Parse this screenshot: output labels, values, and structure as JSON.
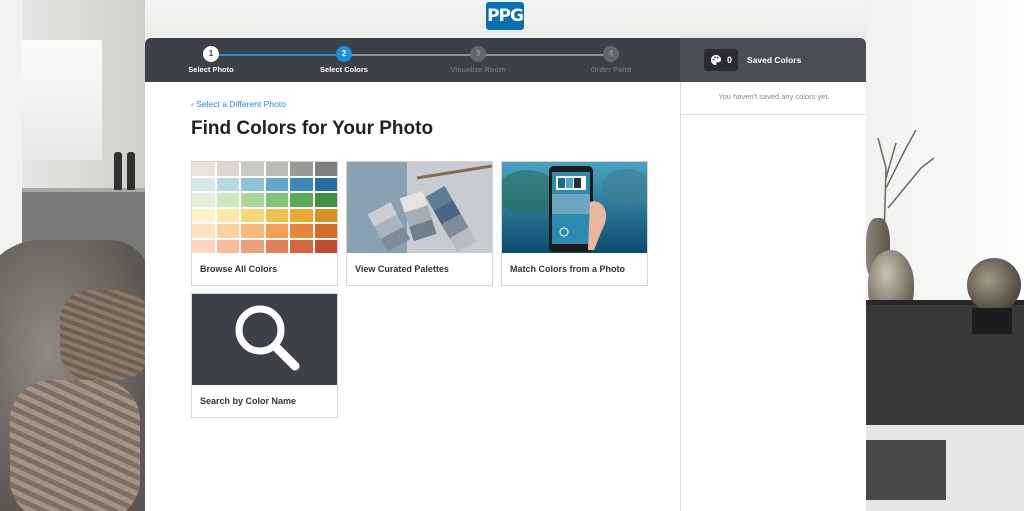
{
  "brand": {
    "logo_text": "PPG",
    "accent": "#1e8ee0",
    "header_bg": "#3d4046"
  },
  "steps": [
    {
      "num": "1",
      "label": "Select Photo",
      "state": "done"
    },
    {
      "num": "2",
      "label": "Select Colors",
      "state": "current"
    },
    {
      "num": "3",
      "label": "Visualize Room",
      "state": "todo"
    },
    {
      "num": "4",
      "label": "Order Paint",
      "state": "todo"
    }
  ],
  "saved": {
    "count": "0",
    "label": "Saved Colors",
    "empty_message": "You haven't saved any colors yet.",
    "icon": "palette-icon"
  },
  "main": {
    "back_link": "Select a Different Photo",
    "title": "Find Colors for Your Photo",
    "cards": [
      {
        "label": "Browse All Colors",
        "icon": "swatch-grid"
      },
      {
        "label": "View Curated Palettes",
        "icon": "palette-fan"
      },
      {
        "label": "Match Colors from a Photo",
        "icon": "phone-photo"
      },
      {
        "label": "Search by Color Name",
        "icon": "search-icon"
      }
    ],
    "swatches": [
      "#e8e3d8",
      "#dcd8cf",
      "#c9c9c3",
      "#b9bab5",
      "#9a9b97",
      "#7e807d",
      "#d6e7ec",
      "#b8d8e4",
      "#8fc1d9",
      "#62a6cc",
      "#3b89b9",
      "#256f9e",
      "#e4f0d8",
      "#cde6bf",
      "#a9d79a",
      "#83c574",
      "#5bad55",
      "#3f9143",
      "#fdf2c9",
      "#fbe7a6",
      "#f7d67a",
      "#f2c251",
      "#eaa932",
      "#d98e22",
      "#fde3c0",
      "#fbd19c",
      "#f7b975",
      "#f29f52",
      "#e88437",
      "#d46a26",
      "#fbd7c2",
      "#f6bc9c",
      "#ef9f78",
      "#e58159",
      "#d56541",
      "#be4e2f"
    ]
  }
}
